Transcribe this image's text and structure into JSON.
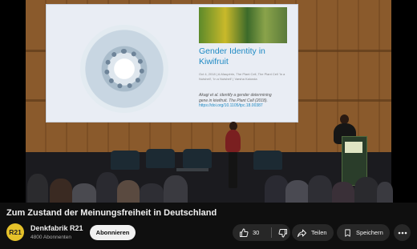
{
  "video": {
    "slide": {
      "title": "Gender Identity in Kiwifruit",
      "meta": "Oct 4, 2018 | A.Maupérin, The Plant Cell, The Plant Cell 'In a Nutshell', 'In a Nutshell' | Varsha Kalonda",
      "citation_line1": "Akagi et al. identify a gender determining",
      "citation_line2": "gene in kiwifruit. The Plant Cell (2018).",
      "citation_line3": "https://doi.org/10.1105/tpc.18.00387"
    }
  },
  "title": "Zum Zustand der Meinungsfreiheit in Deutschland",
  "channel": {
    "avatar_text": "R21",
    "name": "Denkfabrik R21",
    "subscribers": "4800 Abonnenten",
    "subscribe_label": "Abonnieren"
  },
  "actions": {
    "like_count": "30",
    "share_label": "Teilen",
    "save_label": "Speichern"
  },
  "colors": {
    "background": "#0f0f0f",
    "pill": "#272727",
    "slide_title": "#1f8ac4",
    "avatar": "#e6c22a"
  },
  "icons": [
    "thumbs-up-icon",
    "thumbs-down-icon",
    "share-icon",
    "bookmark-icon",
    "more-icon"
  ]
}
